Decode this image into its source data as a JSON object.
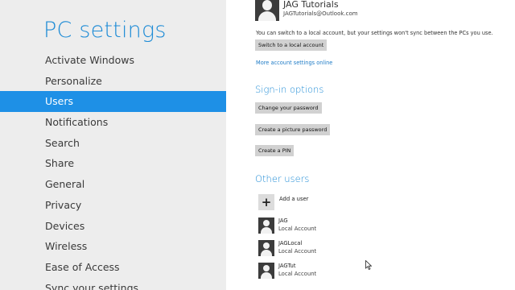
{
  "sidebar": {
    "title": "PC settings",
    "items": [
      {
        "label": "Activate Windows"
      },
      {
        "label": "Personalize"
      },
      {
        "label": "Users"
      },
      {
        "label": "Notifications"
      },
      {
        "label": "Search"
      },
      {
        "label": "Share"
      },
      {
        "label": "General"
      },
      {
        "label": "Privacy"
      },
      {
        "label": "Devices"
      },
      {
        "label": "Wireless"
      },
      {
        "label": "Ease of Access"
      },
      {
        "label": "Sync your settings"
      }
    ],
    "selected": "Users"
  },
  "account": {
    "name": "JAG Tutorials",
    "email": "JAGTutorials@Outlook.com",
    "note": "You can switch to a local account, but your settings won't sync between the PCs you use.",
    "switch_button": "Switch to a local account",
    "more_link": "More account settings online"
  },
  "signin": {
    "title": "Sign-in options",
    "buttons": [
      {
        "label": "Change your password"
      },
      {
        "label": "Create a picture password"
      },
      {
        "label": "Create a PIN"
      }
    ]
  },
  "other_users": {
    "title": "Other users",
    "add_label": "Add a user",
    "add_glyph": "+",
    "users": [
      {
        "name": "JAG",
        "type": "Local Account"
      },
      {
        "name": "JAGLocal",
        "type": "Local Account"
      },
      {
        "name": "JAGTut",
        "type": "Local Account"
      }
    ]
  },
  "colors": {
    "accent": "#1f8cd6",
    "selected_bg": "#1e90e6",
    "sidebar_bg": "#ededed",
    "button_bg": "#d1d1d1",
    "link": "#1e7bc6"
  }
}
